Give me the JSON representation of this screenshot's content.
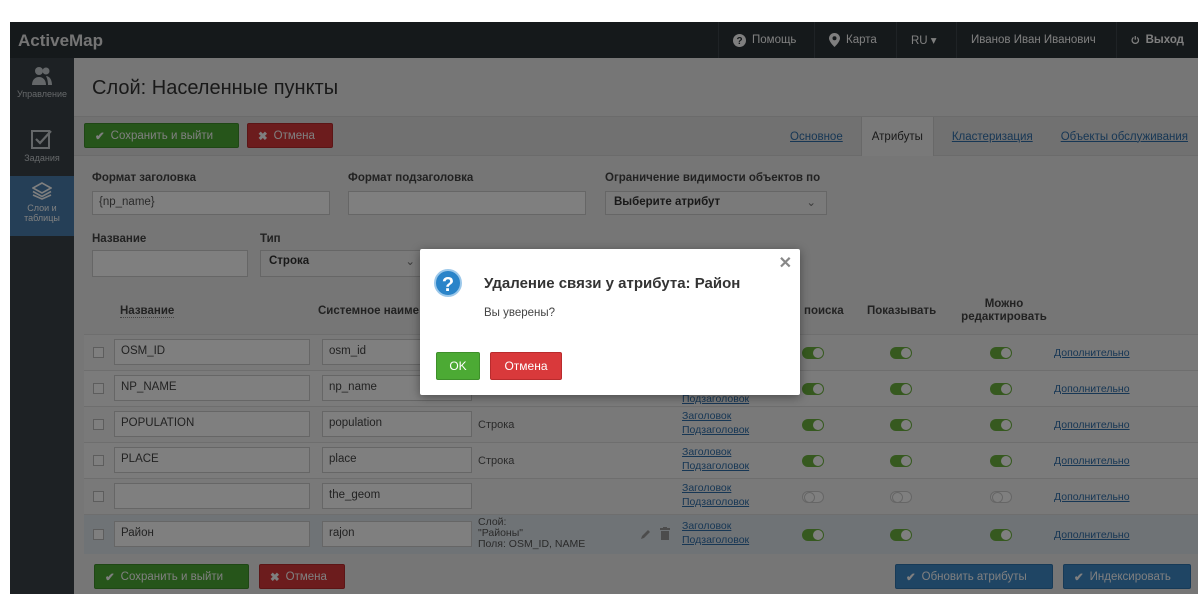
{
  "app": {
    "brand": "ActiveMap"
  },
  "topnav": [
    {
      "label": "Помощь",
      "icon": "question-icon"
    },
    {
      "label": "Карта",
      "icon": "map-pin-icon"
    },
    {
      "label": "RU ▾",
      "icon": ""
    },
    {
      "label": "Иванов Иван Иванович",
      "icon": ""
    },
    {
      "label": "Выход",
      "icon": "power-icon"
    }
  ],
  "sidebar": [
    {
      "label": "Управление",
      "icon": "users-icon"
    },
    {
      "label": "Задания",
      "icon": "checkbox-icon"
    },
    {
      "label": "Слои и таблицы",
      "icon": "layers-icon"
    }
  ],
  "page": {
    "title": "Слой: Населенные пункты"
  },
  "toolbar": {
    "save": "Сохранить и выйти",
    "cancel": "Отмена"
  },
  "tabs": [
    "Основное",
    "Атрибуты",
    "Кластеризация",
    "Объекты обслуживания"
  ],
  "form": {
    "header_format_label": "Формат заголовка",
    "header_format_value": "{np_name}",
    "subheader_format_label": "Формат подзаголовка",
    "subheader_format_value": "",
    "visibility_label": "Ограничение видимости объектов по",
    "visibility_value": "Выберите атрибут",
    "name_label": "Название",
    "name_value": "",
    "type_label": "Тип",
    "type_value": "Строка"
  },
  "table": {
    "headers": {
      "name": "Название",
      "system_name": "Системное наиме",
      "search": "поиска",
      "show": "Показывать",
      "editable": "Можно редактировать"
    },
    "rows": [
      {
        "name": "OSM_ID",
        "system": "osm_id",
        "type": "",
        "link1": "",
        "link2": "",
        "t1": "on",
        "t2": "on",
        "t3": "on",
        "more": "Дополнительно"
      },
      {
        "name": "NP_NAME",
        "system": "np_name",
        "type": "",
        "link1": "",
        "link2": "Подзаголовок",
        "t1": "on",
        "t2": "on",
        "t3": "on",
        "more": "Дополнительно"
      },
      {
        "name": "POPULATION",
        "system": "population",
        "type": "Строка",
        "link1": "Заголовок",
        "link2": "Подзаголовок",
        "t1": "on",
        "t2": "on",
        "t3": "on",
        "more": "Дополнительно"
      },
      {
        "name": "PLACE",
        "system": "place",
        "type": "Строка",
        "link1": "Заголовок",
        "link2": "Подзаголовок",
        "t1": "on",
        "t2": "on",
        "t3": "on",
        "more": "Дополнительно"
      },
      {
        "name": "",
        "system": "the_geom",
        "type": "",
        "link1": "Заголовок",
        "link2": "Подзаголовок",
        "t1": "off",
        "t2": "off",
        "t3": "off",
        "more": "Дополнительно"
      },
      {
        "name": "Район",
        "system": "rajon",
        "type": "Слой:\n\"Районы\"\nПоля: OSM_ID, NAME",
        "link1": "Заголовок",
        "link2": "Подзаголовок",
        "t1": "on",
        "t2": "on",
        "t3": "on",
        "more": "Дополнительно"
      }
    ]
  },
  "footer": {
    "save": "Сохранить и выйти",
    "cancel": "Отмена",
    "update_attrs": "Обновить атрибуты",
    "index": "Индексировать"
  },
  "modal": {
    "title": "Удаление связи у атрибута: Район",
    "text": "Вы уверены?",
    "ok": "OK",
    "cancel": "Отмена"
  },
  "colors": {
    "green": "#4caa34",
    "red": "#d9393b",
    "blue": "#3e8ac9",
    "topbar": "#2b3237",
    "sidebar": "#3b4348",
    "sidebar_active": "#4a7fae"
  }
}
